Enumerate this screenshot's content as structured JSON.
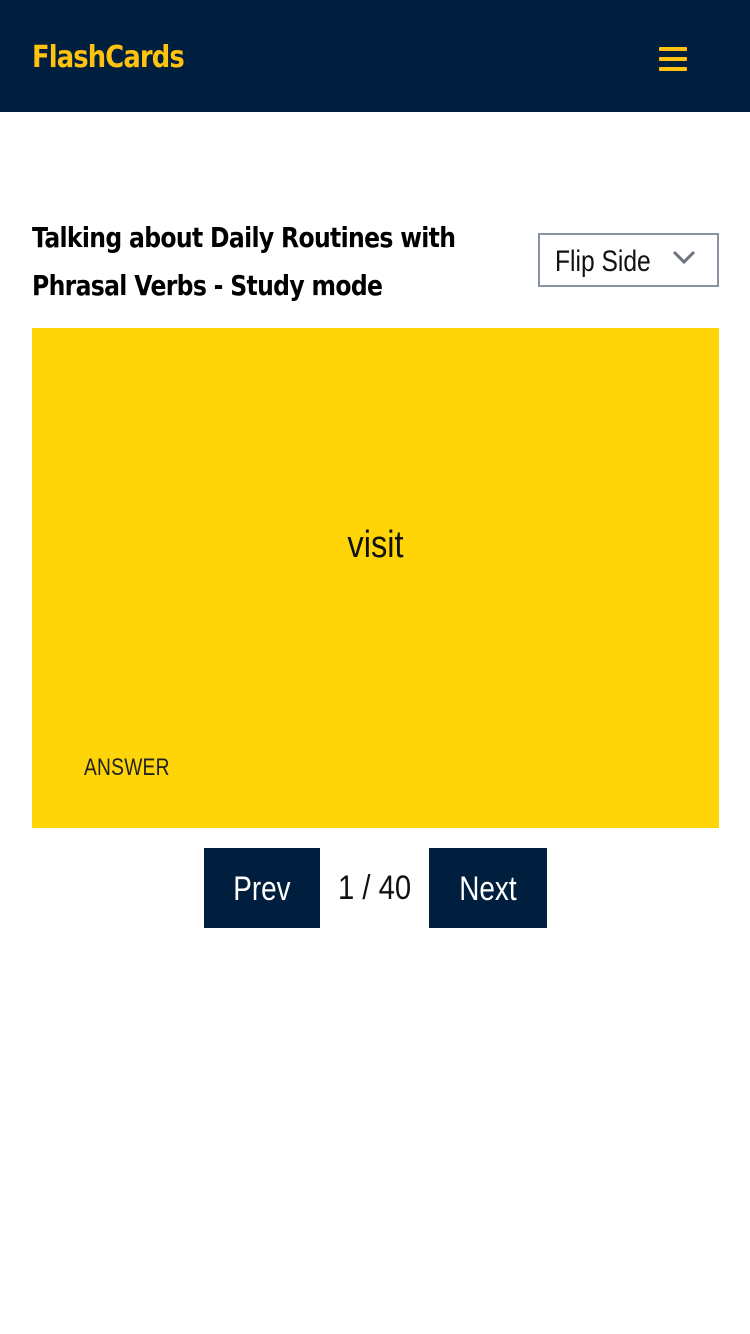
{
  "header": {
    "brand": "FlashCards",
    "menu_icon": "hamburger-menu-icon"
  },
  "deck": {
    "title_line1": "Talking about Daily Routines with",
    "title_line2": "Phrasal Verbs - Study mode"
  },
  "flip_select": {
    "selected": "Flip Side",
    "icon": "chevron-down-icon"
  },
  "card": {
    "term": "visit",
    "side_label": "ANSWER"
  },
  "pagination": {
    "prev_label": "Prev",
    "counter": "1 / 40",
    "next_label": "Next"
  },
  "colors": {
    "header_bg": "#001f3f",
    "brand_accent": "#ffc20e",
    "card_bg": "#ffd507",
    "button_bg": "#001f3f"
  }
}
